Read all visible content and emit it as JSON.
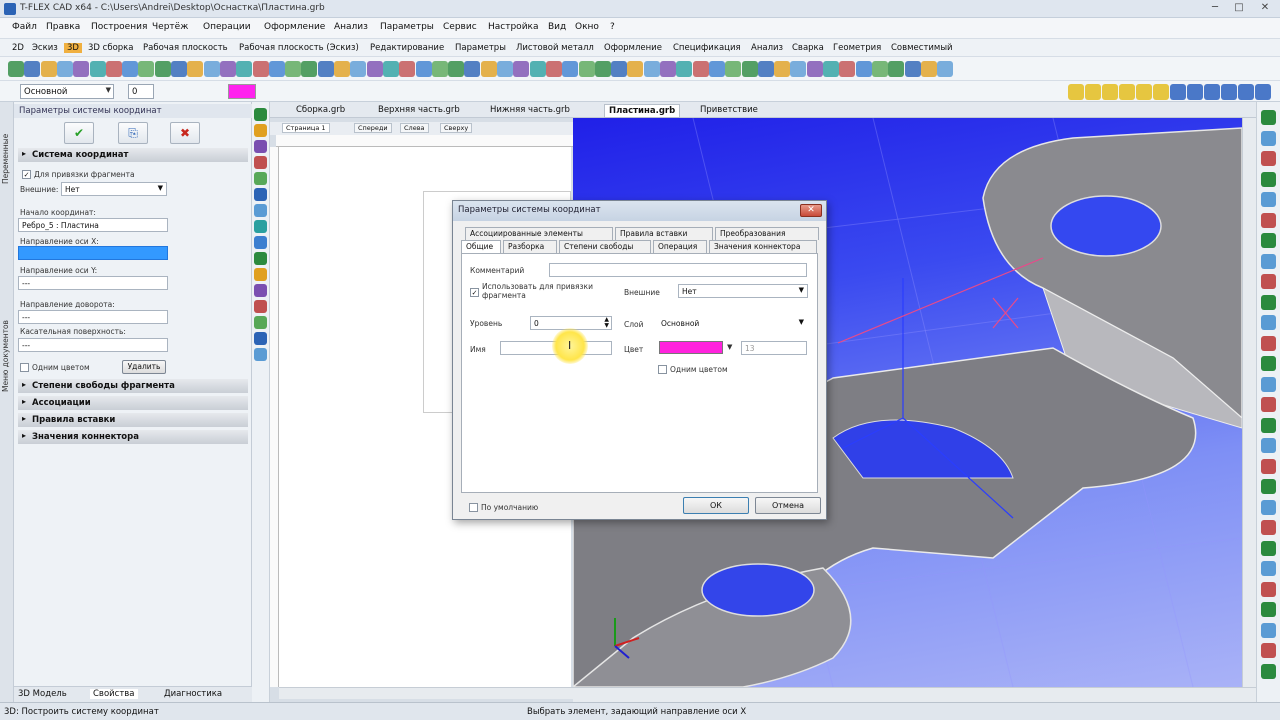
{
  "window": {
    "title": "T-FLEX CAD x64 - C:\\Users\\Andrei\\Desktop\\Оснастка\\Пластина.grb",
    "controls": {
      "minimize": "─",
      "maximize": "□",
      "close": "✕"
    }
  },
  "menu": [
    "Файл",
    "Правка",
    "Построения",
    "Чертёж",
    "Операции",
    "Оформление",
    "Анализ",
    "Параметры",
    "Сервис",
    "Настройка",
    "Вид",
    "Окно",
    "?"
  ],
  "ribbon_tabs": [
    "2D",
    "Эскиз",
    "3D",
    "3D сборка",
    "Рабочая плоскость",
    "Рабочая плоскость (Эскиз)",
    "Редактирование",
    "Параметры",
    "Листовой металл",
    "Оформление",
    "Спецификация",
    "Анализ",
    "Сварка",
    "Геометрия",
    "Совместимый"
  ],
  "props_toolbar": {
    "layer": "Основной",
    "level": "0"
  },
  "left_panel": {
    "header": "Параметры системы координат",
    "side_tabs": [
      "Переменные",
      "Меню документов"
    ],
    "buttons": {
      "ok": "✔",
      "copy": "⎘",
      "cancel": "✖"
    },
    "section_main": "Система координат",
    "chk_bind_label": "Для привязки фрагмента",
    "chk_bind_mark": "✓",
    "external_label": "Внешние:",
    "external_value": "Нет",
    "origin_label": "Начало координат:",
    "origin_value": "Ребро_5 : Пластина",
    "x_label": "Направление оси X:",
    "x_value": "",
    "y_label": "Направление оси Y:",
    "y_value": "---",
    "rot_label": "Направление доворота:",
    "rot_value": "---",
    "tangent_label": "Касательная поверхность:",
    "tangent_value": "---",
    "one_color_label": "Одним цветом",
    "delete_button": "Удалить",
    "sections": [
      "Степени свободы фрагмента",
      "Ассоциации",
      "Правила вставки",
      "Значения коннектора"
    ],
    "bottom_tabs": [
      "3D Модель",
      "Свойства",
      "Диагностика"
    ]
  },
  "doc_tabs": [
    "Сборка.grb",
    "Верхняя часть.grb",
    "Нижняя часть.grb",
    "Пластина.grb",
    "Приветствие"
  ],
  "page_tabs": [
    "Страница 1",
    "Спереди",
    "Слева",
    "Сверху"
  ],
  "dialog": {
    "title": "Параметры системы координат",
    "tabs_row1": [
      "Ассоциированные элементы",
      "Правила вставки",
      "Преобразования"
    ],
    "tabs_row2": [
      "Общие",
      "Разборка",
      "Степени свободы",
      "Операция",
      "Значения коннектора"
    ],
    "comment_label": "Комментарий",
    "comment_value": "",
    "use_bind_label": "Использовать для привязки фрагмента",
    "use_bind_mark": "✓",
    "external_label": "Внешние",
    "external_value": "Нет",
    "level_label": "Уровень",
    "level_value": "0",
    "layer_label": "Слой",
    "layer_value": "Основной",
    "name_label": "Имя",
    "name_value": "",
    "color_label": "Цвет",
    "color_value": "#ff22dd",
    "color_num": "13",
    "one_color_label": "Одним цветом",
    "default_label": "По умолчанию",
    "ok": "ОК",
    "cancel": "Отмена"
  },
  "status": {
    "left": "3D: Построить систему координат",
    "center": "Выбрать элемент, задающий направление оси X"
  }
}
